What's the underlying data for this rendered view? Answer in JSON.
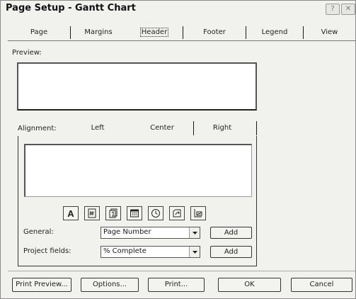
{
  "window": {
    "title": "Page Setup - Gantt Chart",
    "help_glyph": "?",
    "close_glyph": "✕"
  },
  "tabs": [
    {
      "label": "Page"
    },
    {
      "label": "Margins"
    },
    {
      "label": "Header",
      "active": true
    },
    {
      "label": "Footer"
    },
    {
      "label": "Legend"
    },
    {
      "label": "View"
    }
  ],
  "preview_label": "Preview:",
  "alignment": {
    "label": "Alignment:",
    "tabs": [
      {
        "label": "Left"
      },
      {
        "label": "Center",
        "active": true
      },
      {
        "label": "Right"
      }
    ]
  },
  "toolbar_icons": [
    {
      "name": "format-text-font-icon",
      "glyph": "A"
    },
    {
      "name": "page-number-icon"
    },
    {
      "name": "total-pages-icon"
    },
    {
      "name": "current-date-icon"
    },
    {
      "name": "current-time-icon"
    },
    {
      "name": "file-name-icon"
    },
    {
      "name": "insert-picture-icon"
    }
  ],
  "general": {
    "label": "General:",
    "value": "Page Number",
    "add_label": "Add"
  },
  "project_fields": {
    "label": "Project fields:",
    "value": "% Complete",
    "add_label": "Add"
  },
  "buttons": {
    "print_preview": "Print Preview...",
    "options": "Options...",
    "print": "Print...",
    "ok": "OK",
    "cancel": "Cancel"
  }
}
